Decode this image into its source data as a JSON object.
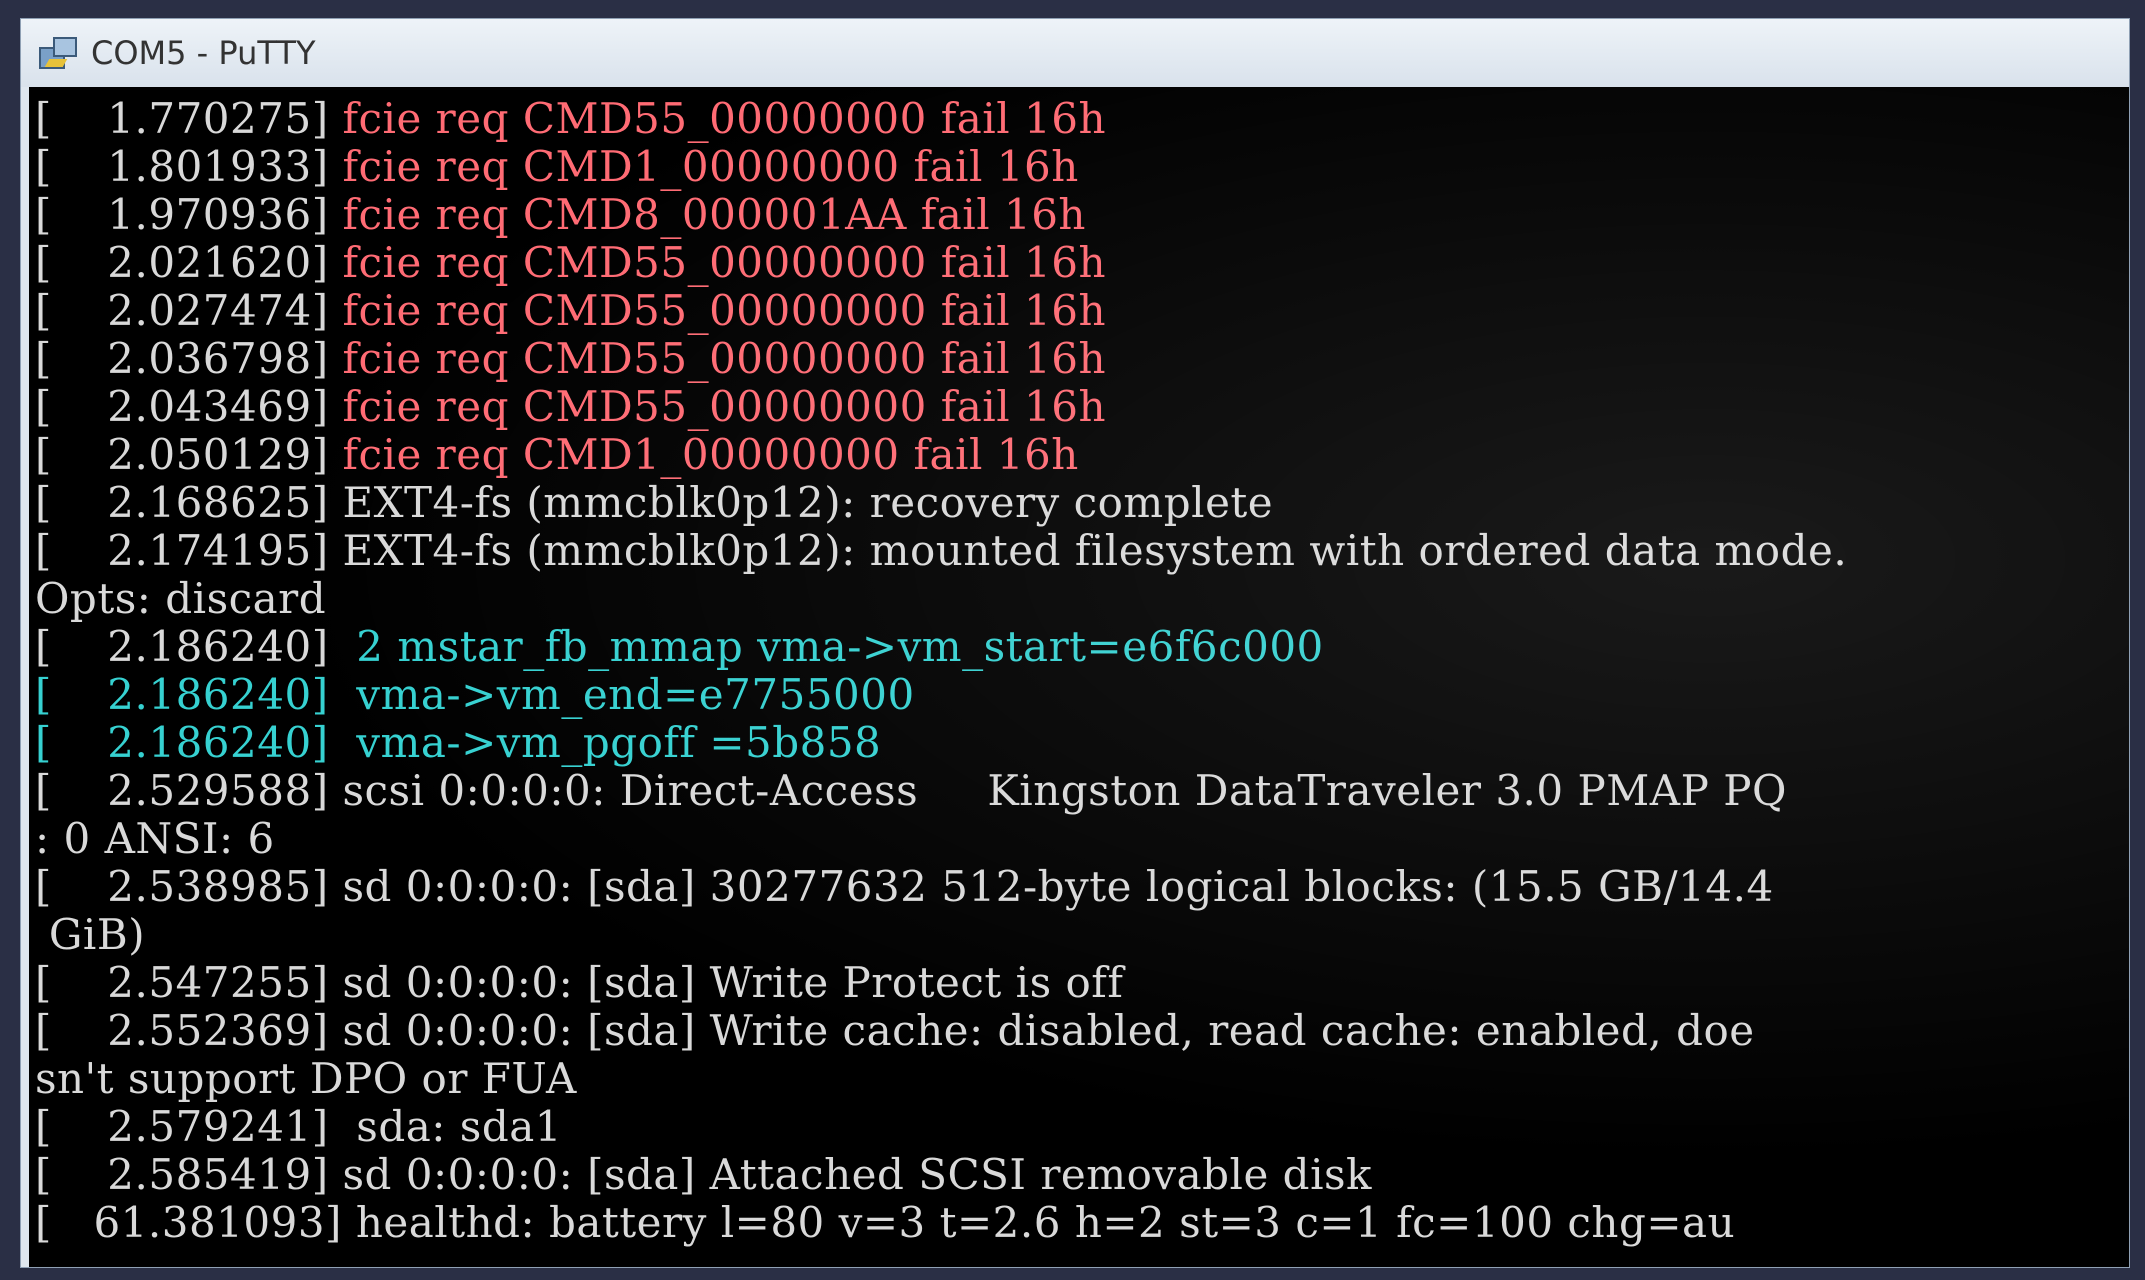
{
  "window": {
    "title": "COM5 - PuTTY"
  },
  "colors": {
    "normal": "#d9d9d9",
    "error": "#ff6b74",
    "info": "#36d1d1",
    "background": "#000000"
  },
  "lines": [
    {
      "prefix": "[    1.770275] ",
      "text": "fcie req CMD55_00000000 fail 16h",
      "color": "red"
    },
    {
      "prefix": "[    1.801933] ",
      "text": "fcie req CMD1_00000000 fail 16h",
      "color": "red"
    },
    {
      "prefix": "[    1.970936] ",
      "text": "fcie req CMD8_000001AA fail 16h",
      "color": "red"
    },
    {
      "prefix": "[    2.021620] ",
      "text": "fcie req CMD55_00000000 fail 16h",
      "color": "red"
    },
    {
      "prefix": "[    2.027474] ",
      "text": "fcie req CMD55_00000000 fail 16h",
      "color": "red"
    },
    {
      "prefix": "[    2.036798] ",
      "text": "fcie req CMD55_00000000 fail 16h",
      "color": "red"
    },
    {
      "prefix": "[    2.043469] ",
      "text": "fcie req CMD55_00000000 fail 16h",
      "color": "red"
    },
    {
      "prefix": "[    2.050129] ",
      "text": "fcie req CMD1_00000000 fail 16h",
      "color": "red"
    },
    {
      "prefix": "[    2.168625] ",
      "text": "EXT4-fs (mmcblk0p12): recovery complete",
      "color": "gray"
    },
    {
      "prefix": "[    2.174195] ",
      "text": "EXT4-fs (mmcblk0p12): mounted filesystem with ordered data mode.",
      "color": "gray"
    },
    {
      "prefix": "",
      "text": "Opts: discard",
      "color": "gray"
    },
    {
      "prefix": "[    2.186240] ",
      "text": " 2 mstar_fb_mmap vma->vm_start=e6f6c000",
      "color": "cyan"
    },
    {
      "prefix": "[    2.186240] ",
      "text": " vma->vm_end=e7755000",
      "color": "cyan",
      "prefix_color": "cyan"
    },
    {
      "prefix": "[    2.186240] ",
      "text": " vma->vm_pgoff =5b858",
      "color": "cyan",
      "prefix_color": "cyan"
    },
    {
      "prefix": "[    2.529588] ",
      "text": "scsi 0:0:0:0: Direct-Access     Kingston DataTraveler 3.0 PMAP PQ",
      "color": "gray"
    },
    {
      "prefix": "",
      "text": ": 0 ANSI: 6",
      "color": "gray"
    },
    {
      "prefix": "[    2.538985] ",
      "text": "sd 0:0:0:0: [sda] 30277632 512-byte logical blocks: (15.5 GB/14.4",
      "color": "gray"
    },
    {
      "prefix": "",
      "text": " GiB)",
      "color": "gray"
    },
    {
      "prefix": "[    2.547255] ",
      "text": "sd 0:0:0:0: [sda] Write Protect is off",
      "color": "gray"
    },
    {
      "prefix": "[    2.552369] ",
      "text": "sd 0:0:0:0: [sda] Write cache: disabled, read cache: enabled, doe",
      "color": "gray"
    },
    {
      "prefix": "",
      "text": "sn't support DPO or FUA",
      "color": "gray"
    },
    {
      "prefix": "[    2.579241] ",
      "text": " sda: sda1",
      "color": "gray"
    },
    {
      "prefix": "[    2.585419] ",
      "text": "sd 0:0:0:0: [sda] Attached SCSI removable disk",
      "color": "gray"
    },
    {
      "prefix": "[   61.381093] ",
      "text": "healthd: battery l=80 v=3 t=2.6 h=2 st=3 c=1 fc=100 chg=au",
      "color": "gray"
    }
  ]
}
